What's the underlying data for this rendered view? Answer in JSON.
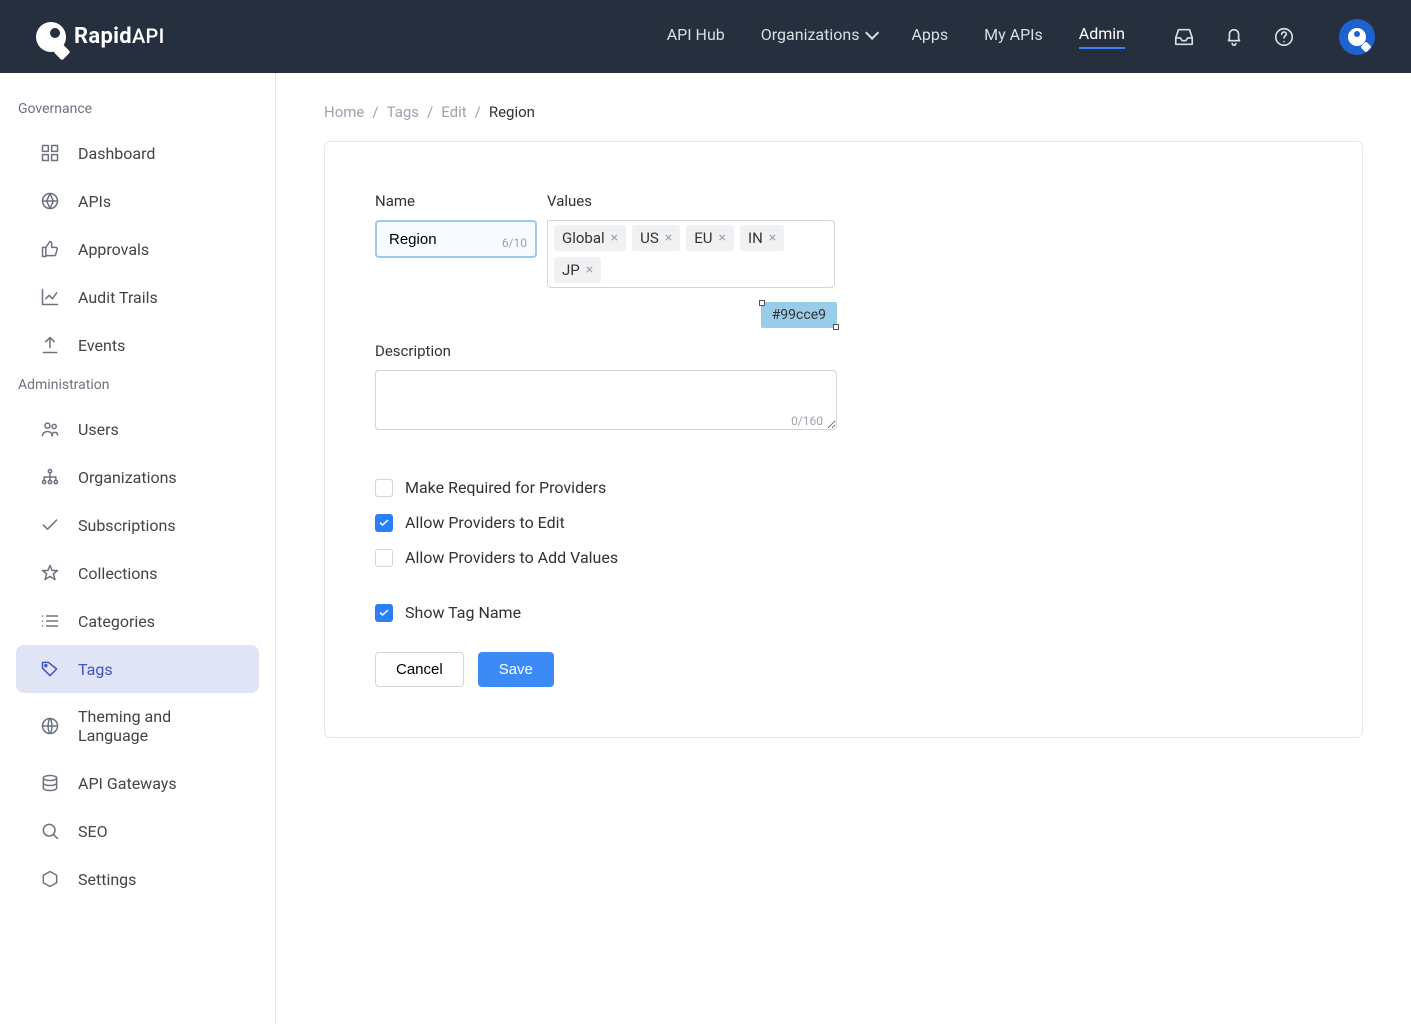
{
  "brand": {
    "name": "Rapid",
    "suffix": "API"
  },
  "nav": {
    "items": [
      "API Hub",
      "Organizations",
      "Apps",
      "My APIs",
      "Admin"
    ],
    "active": 4
  },
  "sidebar": {
    "groups": [
      {
        "label": "Governance",
        "items": [
          {
            "label": "Dashboard",
            "icon": "grid"
          },
          {
            "label": "APIs",
            "icon": "aperture"
          },
          {
            "label": "Approvals",
            "icon": "thumbs-up"
          },
          {
            "label": "Audit Trails",
            "icon": "chart"
          },
          {
            "label": "Events",
            "icon": "upload"
          }
        ]
      },
      {
        "label": "Administration",
        "items": [
          {
            "label": "Users",
            "icon": "users"
          },
          {
            "label": "Organizations",
            "icon": "tree"
          },
          {
            "label": "Subscriptions",
            "icon": "check"
          },
          {
            "label": "Collections",
            "icon": "star"
          },
          {
            "label": "Categories",
            "icon": "list"
          },
          {
            "label": "Tags",
            "icon": "tag",
            "active": true
          },
          {
            "label": "Theming and Language",
            "icon": "globe"
          },
          {
            "label": "API Gateways",
            "icon": "database"
          },
          {
            "label": "SEO",
            "icon": "search"
          },
          {
            "label": "Settings",
            "icon": "hex"
          }
        ]
      }
    ]
  },
  "breadcrumb": [
    "Home",
    "Tags",
    "Edit",
    "Region"
  ],
  "form": {
    "name_label": "Name",
    "name_value": "Region",
    "name_count": "6/10",
    "values_label": "Values",
    "values": [
      "Global",
      "US",
      "EU",
      "IN",
      "JP"
    ],
    "color_swatch": "#99cce9",
    "description_label": "Description",
    "description_value": "",
    "description_count": "0/160",
    "checkboxes": [
      {
        "label": "Make Required for Providers",
        "checked": false
      },
      {
        "label": "Allow Providers to Edit",
        "checked": true
      },
      {
        "label": "Allow Providers to Add Values",
        "checked": false
      },
      {
        "label": "Show Tag Name",
        "checked": true,
        "spaced": true
      }
    ],
    "cancel": "Cancel",
    "save": "Save"
  }
}
